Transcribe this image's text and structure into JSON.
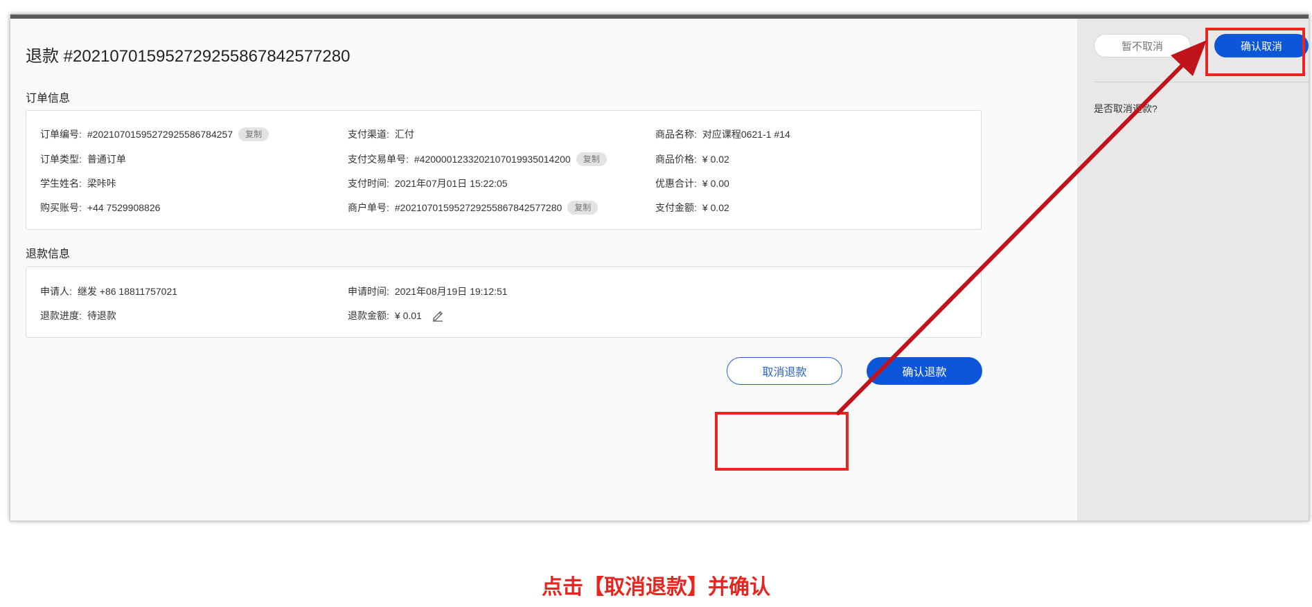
{
  "page_title": "退款 #20210701595272925586784257​7280",
  "order_section": {
    "title": "订单信息",
    "fields": {
      "order_no_label": "订单编号:",
      "order_no_value": "#20210701595272925586784257",
      "order_type_label": "订单类型:",
      "order_type_value": "普通订单",
      "student_label": "学生姓名:",
      "student_value": "梁咔咔",
      "buyer_label": "购买账号:",
      "buyer_value": "+44 7529908826",
      "channel_label": "支付渠道:",
      "channel_value": "汇付",
      "trade_no_label": "支付交易单号:",
      "trade_no_value": "#4200001233202107019935014200",
      "pay_time_label": "支付时间:",
      "pay_time_value": "2021年07月01日 15:22:05",
      "merchant_no_label": "商户单号:",
      "merchant_no_value": "#202107015952729255867842577280",
      "product_name_label": "商品名称:",
      "product_name_value": "对应课程0621-1 #14",
      "product_price_label": "商品价格:",
      "product_price_value": "¥ 0.02",
      "discount_label": "优惠合计:",
      "discount_value": "¥ 0.00",
      "paid_label": "支付金额:",
      "paid_value": "¥ 0.02"
    },
    "copy_label": "复制"
  },
  "refund_section": {
    "title": "退款信息",
    "fields": {
      "applicant_label": "申请人:",
      "applicant_value": "继发 +86 18811757021",
      "progress_label": "退款进度:",
      "progress_value": "待退款",
      "apply_time_label": "申请时间:",
      "apply_time_value": "2021年08月19日 19:12:51",
      "amount_label": "退款金额:",
      "amount_value": "¥ 0.01"
    },
    "edit_icon": "pencil-icon"
  },
  "actions": {
    "cancel_refund": "取消退款",
    "confirm_refund": "确认退款"
  },
  "side_panel": {
    "not_cancel": "暂不取消",
    "confirm_cancel": "确认取消",
    "question": "是否取消退款?"
  },
  "caption": "点击【取消退款】并确认",
  "colors": {
    "primary": "#0d55d9",
    "annotation": "#e8251e",
    "arrow": "#c0141a"
  }
}
